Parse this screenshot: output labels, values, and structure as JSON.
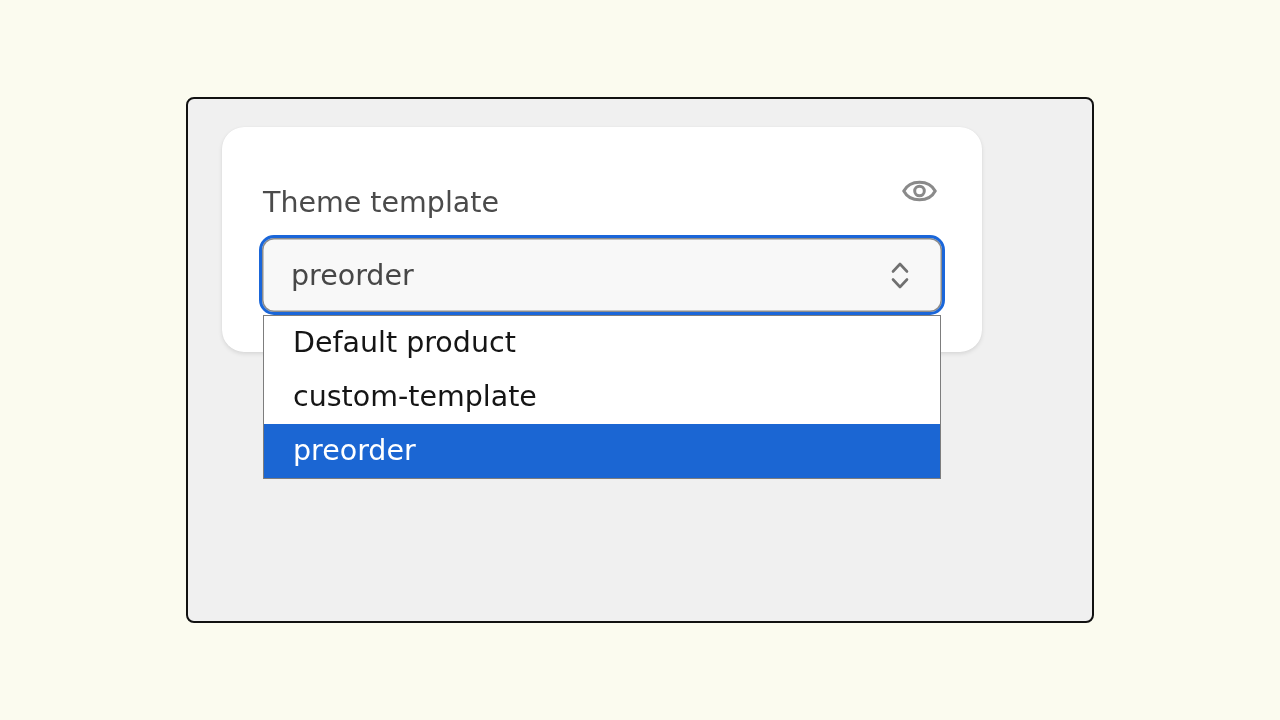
{
  "card": {
    "label": "Theme template",
    "select": {
      "value": "preorder",
      "focused": true,
      "expanded": true,
      "options": [
        {
          "label": "Default product",
          "selected": false
        },
        {
          "label": "custom-template",
          "selected": false
        },
        {
          "label": "preorder",
          "selected": true
        }
      ]
    }
  }
}
